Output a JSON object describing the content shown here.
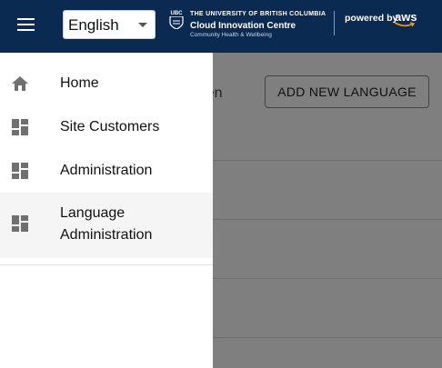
{
  "header": {
    "menu_icon": "hamburger-menu-icon",
    "language_select": {
      "value": "English"
    },
    "ubc": {
      "crest_text": "UBC",
      "line1": "THE UNIVERSITY OF BRITISH COLUMBIA",
      "line2": "Cloud Innovation Centre",
      "line3": "Community Health & Wellbeing"
    },
    "aws": {
      "powered_by": "powered by",
      "aws": "aws"
    },
    "colors": {
      "appbar": "#0b2a52"
    }
  },
  "page": {
    "language_code_text": "de: en",
    "add_button_label": "ADD NEW LANGUAGE"
  },
  "drawer": {
    "items": [
      {
        "label": "Home",
        "icon": "home-icon",
        "selected": false
      },
      {
        "label": "Site Customers",
        "icon": "dashboard-icon",
        "selected": false
      },
      {
        "label": "Administration",
        "icon": "dashboard-icon",
        "selected": false
      },
      {
        "label_line1": "Language",
        "label_line2": "Administration",
        "icon": "dashboard-icon",
        "selected": true
      }
    ]
  }
}
